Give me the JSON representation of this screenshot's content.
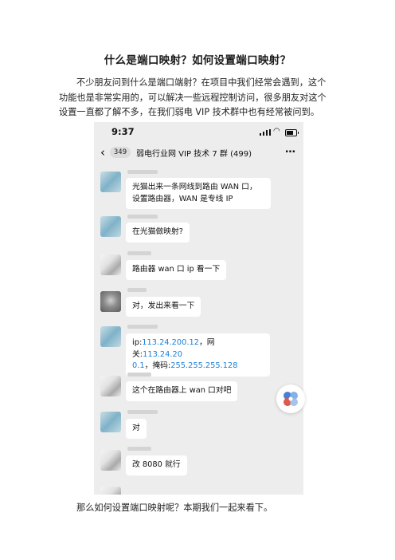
{
  "article": {
    "title": "什么是端口映射？如何设置端口映射？",
    "intro_line1": "不少朋友问到什么是端口端射？在项目中我们经常会遇到，这个",
    "intro_line2": "功能也是非常实用的，可以解决一些远程控制访问，很多朋友对这个",
    "intro_line3": "设置一直都了解不多，在我们弱电 VIP 技术群中也有经常被问到。",
    "outro": "那么如何设置端口映射呢？本期我们一起来看下。"
  },
  "phone": {
    "status_time": "9:37",
    "wifi_icon": "wifi-icon",
    "unread_badge": "349",
    "chat_title": "弱电行业网 VIP 技术 7 群 (499)",
    "more_icon": "more-icon",
    "messages": [
      {
        "avatar": "blue",
        "line1": "光猫出来一条网线到路由 WAN 口，",
        "line2": "设置路由器，WAN 是专线 IP"
      },
      {
        "avatar": "blue",
        "line1": "在光猫做映射?"
      },
      {
        "avatar": "gray",
        "line1": "路由器 wan 口 ip 看一下"
      },
      {
        "avatar": "photo",
        "line1": "对，发出来看一下"
      },
      {
        "avatar": "blue",
        "label_ip": "ip:",
        "ip": "113.24.200.12",
        "label_gateway": "，网关:",
        "gateway_part1": "113.24.20",
        "gateway_part2": "0.1",
        "label_mask": "，掩码:",
        "mask": "255.255.255.128"
      },
      {
        "avatar": "gray",
        "line1": "这个在路由器上 wan 口对吧"
      },
      {
        "avatar": "blue",
        "line1": "对"
      },
      {
        "avatar": "gray",
        "line1": "改 8080 就行"
      }
    ]
  },
  "colors": {
    "accent_link": "#1a7fd9",
    "chat_background": "#ededed"
  }
}
